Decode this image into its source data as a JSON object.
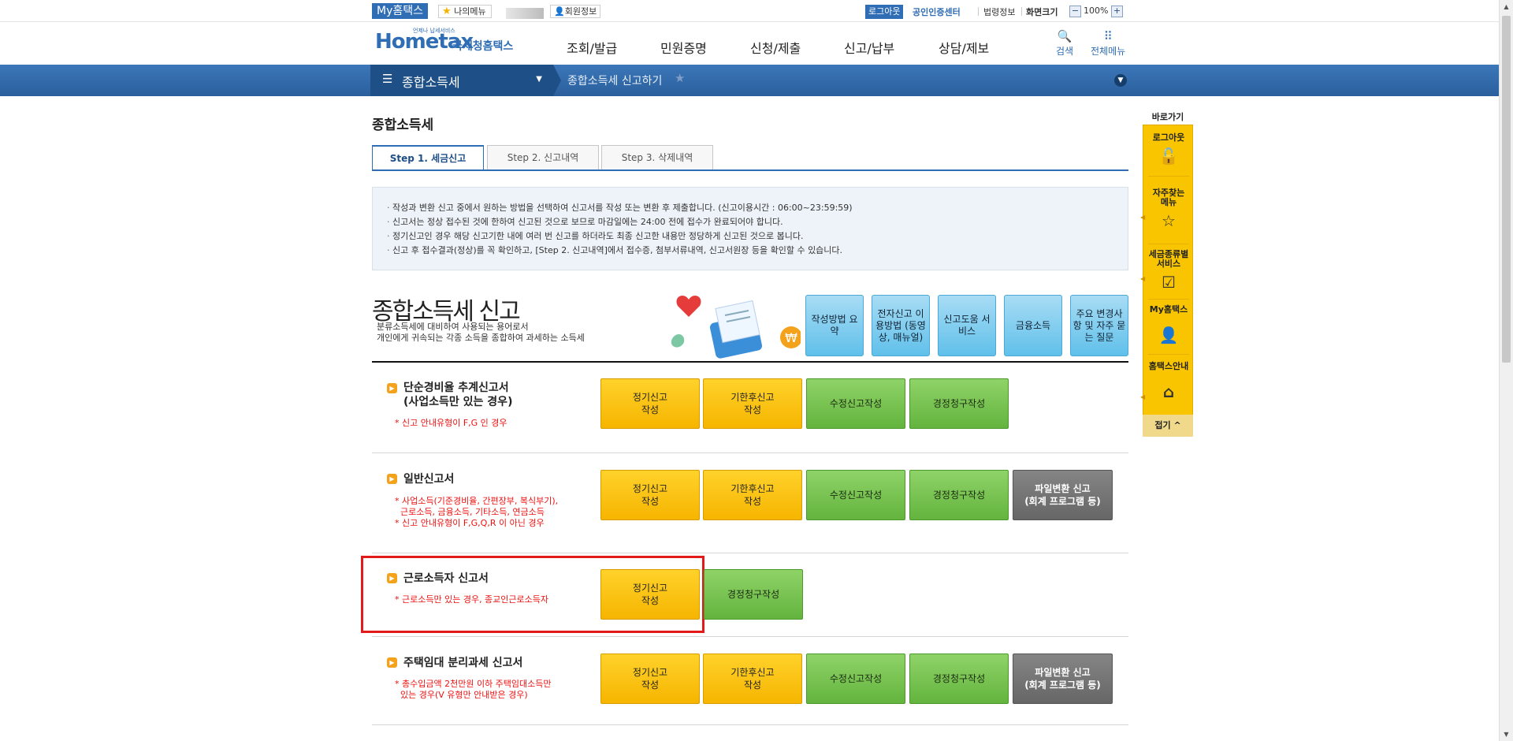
{
  "utilbar": {
    "my_hometax": "My홈택스",
    "my_menu": "나의메뉴",
    "member_info": "회원정보",
    "logout": "로그아웃",
    "certificate_center": "공인인증센터",
    "law_info": "법령정보",
    "screen_size": "화면크기",
    "zoom_minus": "−",
    "zoom_value": "100%",
    "zoom_plus": "+"
  },
  "header": {
    "logo_tagline": "언제나 납세서비스",
    "logo_text": "Hometax",
    "logo_korean": "국세청홈택스",
    "gnb": [
      "조회/발급",
      "민원증명",
      "신청/제출",
      "신고/납부",
      "상담/제보"
    ],
    "search": "검색",
    "all_menu": "전체메뉴"
  },
  "navbar": {
    "menu_title": "종합소득세",
    "breadcrumb": "종합소득세 신고하기"
  },
  "page": {
    "title": "종합소득세",
    "tabs": [
      "Step 1. 세금신고",
      "Step 2. 신고내역",
      "Step 3. 삭제내역"
    ],
    "notices": [
      "작성과 변환 신고 중에서 원하는 방법을 선택하여 신고서를 작성 또는 변환 후 제출합니다. (신고이용시간 : 06:00~23:59:59)",
      "신고서는 정상 접수된 것에 한하여 신고된 것으로 보므로 마감일에는 24:00 전에 접수가 완료되어야 합니다.",
      "정기신고인 경우 해당 신고기한 내에 여러 번 신고를 하더라도 최종 신고한 내용만 정당하게 신고된 것으로 봅니다.",
      "신고 후 접수결과(정상)를 꼭 확인하고, [Step 2. 신고내역]에서 접수증, 첨부서류내역, 신고서원장 등을 확인할 수 있습니다."
    ],
    "big_title": "종합소득세 신고",
    "big_desc_1": "분류소득세에 대비하여 사용되는 용어로서",
    "big_desc_2": "개인에게 귀속되는 각종 소득을 종합하여 과세하는 소득세",
    "side_buttons": [
      "작성방법 요약",
      "전자신고 이용방법 (동영상, 매뉴얼)",
      "신고도움 서비스",
      "금융소득",
      "주요 변경사항 및 자주 묻는 질문"
    ]
  },
  "sections": [
    {
      "title_1": "단순경비율 추계신고서",
      "title_2": "(사업소득만 있는 경우)",
      "notes": [
        "* 신고 안내유형이 F,G 인 경우"
      ],
      "buttons": [
        "정기신고\n작성",
        "기한후신고\n작성",
        "수정신고작성",
        "경정청구작성"
      ]
    },
    {
      "title_1": "일반신고서",
      "notes": [
        "* 사업소득(기준경비율, 간편장부, 복식부기),",
        "  근로소득, 금융소득, 기타소득, 연금소득",
        "* 신고 안내유형이 F,G,Q,R 이 아닌 경우"
      ],
      "buttons": [
        "정기신고\n작성",
        "기한후신고\n작성",
        "수정신고작성",
        "경정청구작성",
        "파일변환 신고\n(회계 프로그램 등)"
      ]
    },
    {
      "title_1": "근로소득자 신고서",
      "notes": [
        "* 근로소득만 있는 경우, 종교인근로소득자"
      ],
      "buttons": [
        "정기신고\n작성",
        "경정청구작성"
      ]
    },
    {
      "title_1": "주택임대 분리과세 신고서",
      "notes": [
        "* 총수입금액 2천만원 이하 주택임대소득만",
        "  있는 경우(V 유형만 안내받은 경우)"
      ],
      "buttons": [
        "정기신고\n작성",
        "기한후신고\n작성",
        "수정신고작성",
        "경정청구작성",
        "파일변환 신고\n(회계 프로그램 등)"
      ]
    }
  ],
  "quickmenu": {
    "title": "바로가기",
    "items": [
      "로그아웃",
      "자주찾는\n메뉴",
      "세금종류별\n서비스",
      "My홈택스",
      "홈택스안내"
    ],
    "close": "접기"
  },
  "colors": {
    "brand_blue": "#2f6db5",
    "yellow_btn": "#f6b500",
    "green_btn": "#63b43e",
    "gray_btn": "#666666",
    "highlight_red": "#e21a1a"
  }
}
